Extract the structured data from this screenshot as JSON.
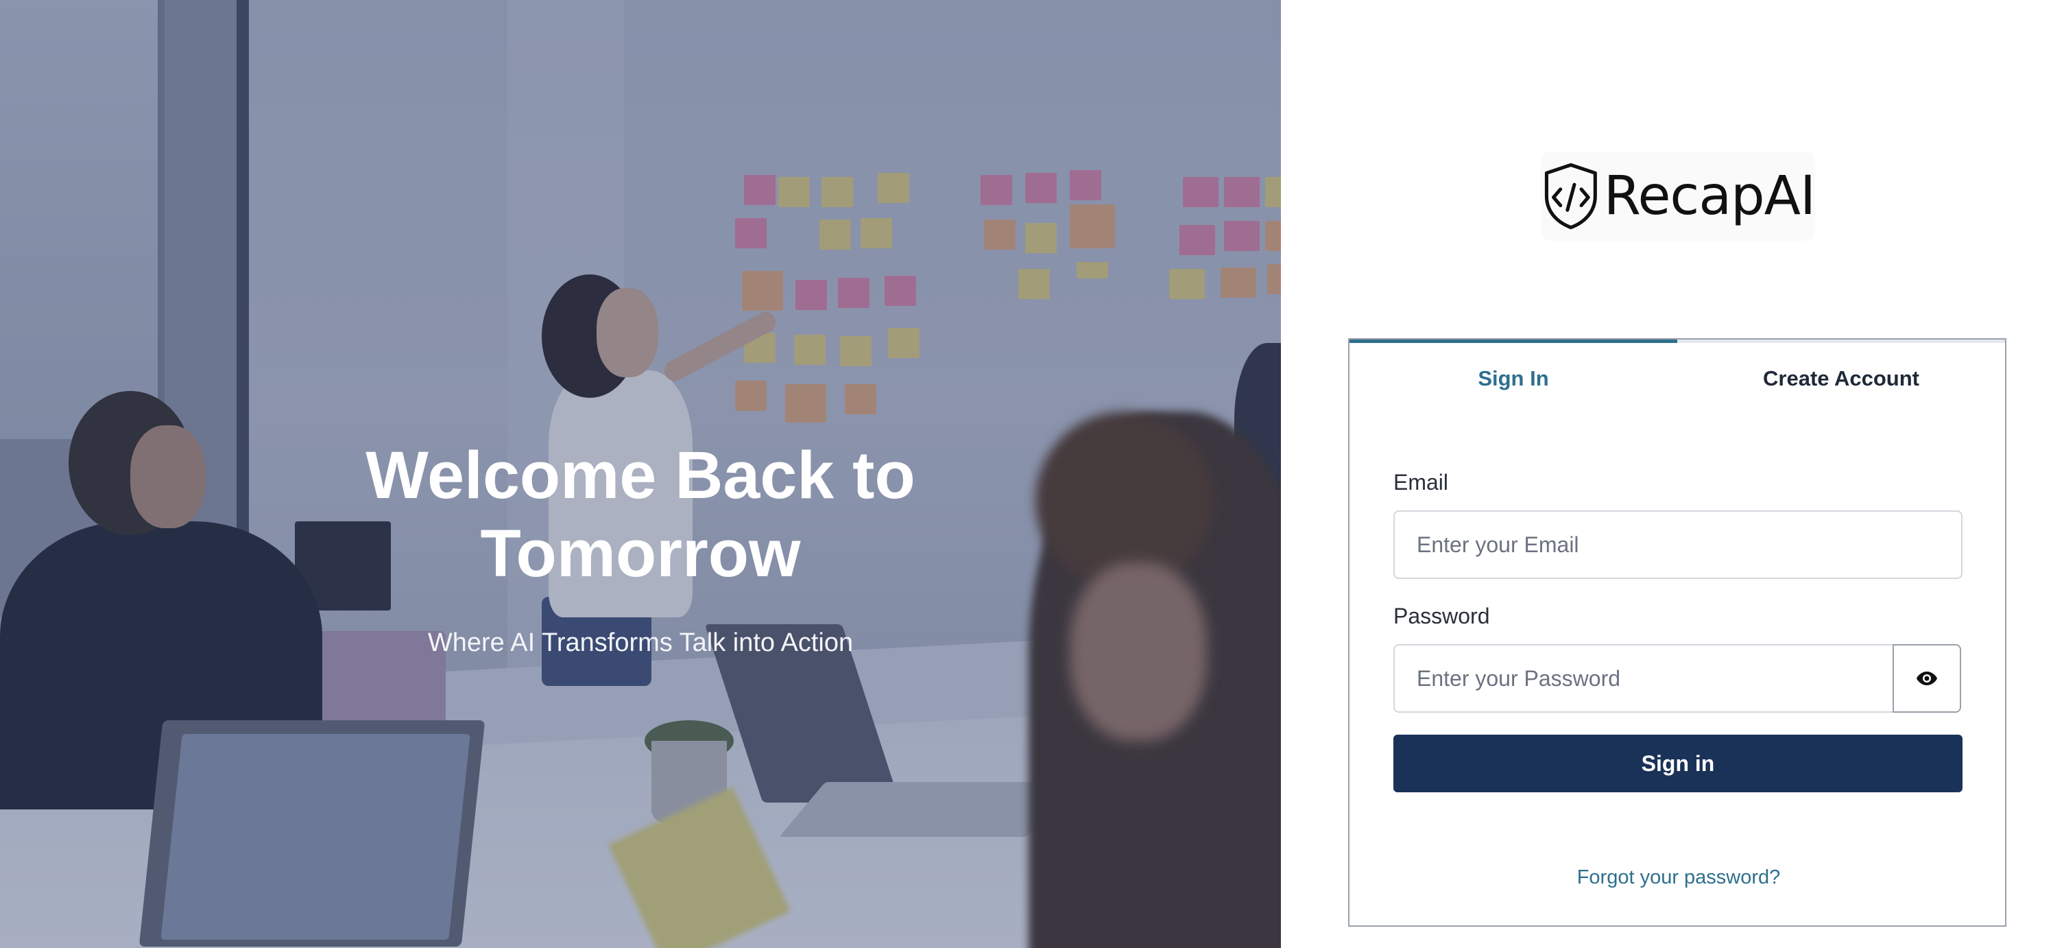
{
  "hero": {
    "title": "Welcome Back to Tomorrow",
    "subtitle": "Where AI Transforms Talk into Action"
  },
  "logo": {
    "brand_name": "RecapAI",
    "icon": "shield-code-icon"
  },
  "auth": {
    "tabs": [
      {
        "label": "Sign In",
        "active": true
      },
      {
        "label": "Create Account",
        "active": false
      }
    ],
    "email": {
      "label": "Email",
      "placeholder": "Enter your Email",
      "value": ""
    },
    "password": {
      "label": "Password",
      "placeholder": "Enter your Password",
      "value": "",
      "toggle_icon": "eye-icon"
    },
    "submit_label": "Sign in",
    "forgot_label": "Forgot your password?"
  },
  "colors": {
    "primary_button": "#1a3257",
    "accent_link": "#2e6f8e",
    "hero_overlay": "#3c4c78"
  }
}
